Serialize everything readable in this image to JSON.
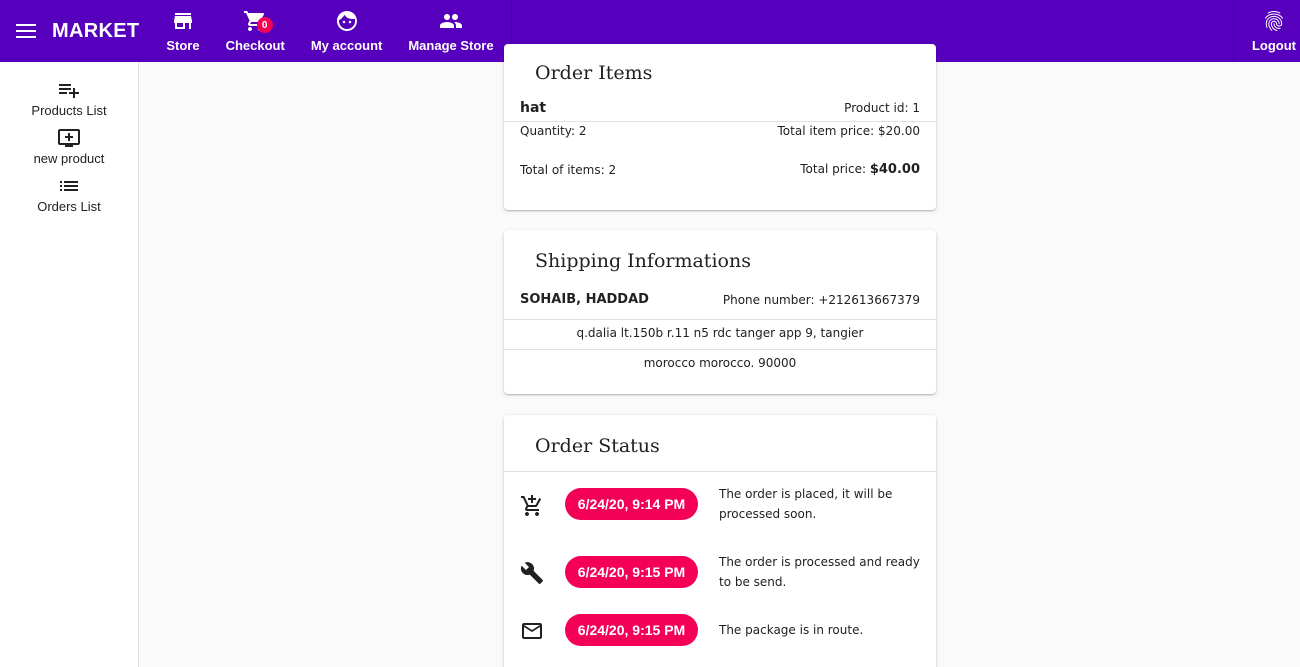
{
  "topbar": {
    "brand": "MARKET",
    "nav": [
      {
        "label": "Store",
        "icon": "store-icon"
      },
      {
        "label": "Checkout",
        "icon": "cart-icon",
        "badge": "0"
      },
      {
        "label": "My account",
        "icon": "face-icon"
      },
      {
        "label": "Manage Store",
        "icon": "people-icon"
      }
    ],
    "logout": {
      "label": "Logout",
      "icon": "fingerprint-icon"
    }
  },
  "sidebar": {
    "items": [
      {
        "label": "Products List",
        "icon": "playlist-add-icon"
      },
      {
        "label": "new product",
        "icon": "add-to-queue-icon"
      },
      {
        "label": "Orders List",
        "icon": "list-icon"
      }
    ]
  },
  "order_items": {
    "title": "Order Items",
    "product_name": "hat",
    "product_id": "Product id: 1",
    "quantity": "Quantity: 2",
    "item_price": "Total item price: $20.00",
    "total_items": "Total of items: 2",
    "total_price_label": "Total price:",
    "total_price_value": "$40.00"
  },
  "shipping": {
    "title": "Shipping Informations",
    "name": "SOHAIB, HADDAD",
    "phone": "Phone number: +212613667379",
    "address_line1": "q.dalia lt.150b r.11 n5 rdc tanger app 9, tangier",
    "address_line2": "morocco morocco. 90000"
  },
  "order_status": {
    "title": "Order Status",
    "events": [
      {
        "icon": "add-shopping-cart-icon",
        "time": "6/24/20, 9:14 PM",
        "text": "The order is placed, it will be processed soon."
      },
      {
        "icon": "wrench-icon",
        "time": "6/24/20, 9:15 PM",
        "text": "The order is processed and ready to be send."
      },
      {
        "icon": "mail-icon",
        "time": "6/24/20, 9:15 PM",
        "text": "The package is in route."
      }
    ]
  },
  "colors": {
    "topbar": "#5600bd",
    "accent": "#f50057"
  }
}
